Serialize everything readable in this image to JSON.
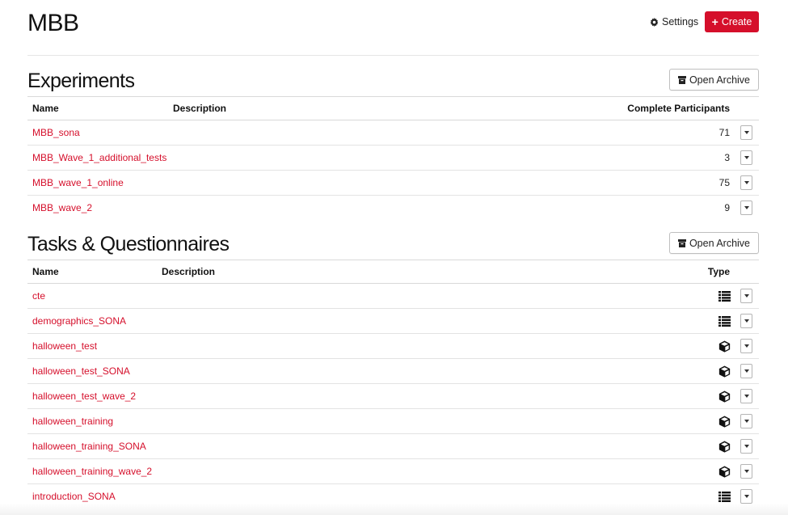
{
  "header": {
    "title": "MBB",
    "settings_label": "Settings",
    "create_label": "Create",
    "accent_color": "#d50f2b"
  },
  "experiments": {
    "title": "Experiments",
    "archive_label": "Open Archive",
    "columns": {
      "name": "Name",
      "description": "Description",
      "participants": "Complete Participants"
    },
    "rows": [
      {
        "name": "MBB_sona",
        "participants": "71"
      },
      {
        "name": "MBB_Wave_1_additional_tests",
        "participants": "3"
      },
      {
        "name": "MBB_wave_1_online",
        "participants": "75"
      },
      {
        "name": "MBB_wave_2",
        "participants": "9"
      }
    ]
  },
  "tasks": {
    "title": "Tasks & Questionnaires",
    "archive_label": "Open Archive",
    "columns": {
      "name": "Name",
      "description": "Description",
      "type": "Type"
    },
    "rows": [
      {
        "name": "cte",
        "type": "list-icon"
      },
      {
        "name": "demographics_SONA",
        "type": "list-icon"
      },
      {
        "name": "halloween_test",
        "type": "cube-icon"
      },
      {
        "name": "halloween_test_SONA",
        "type": "cube-icon"
      },
      {
        "name": "halloween_test_wave_2",
        "type": "cube-icon"
      },
      {
        "name": "halloween_training",
        "type": "cube-icon"
      },
      {
        "name": "halloween_training_SONA",
        "type": "cube-icon"
      },
      {
        "name": "halloween_training_wave_2",
        "type": "cube-icon"
      },
      {
        "name": "introduction_SONA",
        "type": "list-icon"
      }
    ]
  }
}
